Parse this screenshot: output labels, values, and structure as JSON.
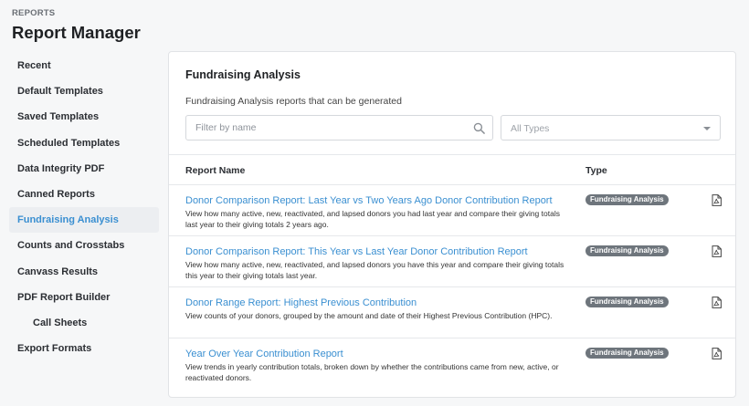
{
  "header": {
    "eyebrow": "REPORTS",
    "title": "Report Manager"
  },
  "sidebar": {
    "items": [
      {
        "label": "Recent"
      },
      {
        "label": "Default Templates"
      },
      {
        "label": "Saved Templates"
      },
      {
        "label": "Scheduled Templates"
      },
      {
        "label": "Data Integrity PDF"
      },
      {
        "label": "Canned Reports"
      },
      {
        "label": "Fundraising Analysis",
        "active": true
      },
      {
        "label": "Counts and Crosstabs"
      },
      {
        "label": "Canvass Results"
      },
      {
        "label": "PDF Report Builder"
      },
      {
        "label": "Call Sheets",
        "sub": true
      },
      {
        "label": "Export Formats"
      }
    ]
  },
  "main": {
    "title": "Fundraising Analysis",
    "description": "Fundraising Analysis reports that can be generated",
    "filter": {
      "placeholder": "Filter by name",
      "value": "",
      "icon": "search-icon"
    },
    "type_select": {
      "selected": "All Types"
    },
    "columns": {
      "name": "Report Name",
      "type": "Type"
    },
    "rows": [
      {
        "name": "Donor Comparison Report: Last Year vs Two Years Ago Donor Contribution Report",
        "description": "View how many active, new, reactivated, and lapsed donors you had last year and compare their giving totals last year to their giving totals 2 years ago.",
        "type": "Fundraising Analysis",
        "action_icon": "pdf-icon"
      },
      {
        "name": "Donor Comparison Report: This Year vs Last Year Donor Contribution Report",
        "description": "View how many active, new, reactivated, and lapsed donors you have this year and compare their giving totals this year to their giving totals last year.",
        "type": "Fundraising Analysis",
        "action_icon": "pdf-icon"
      },
      {
        "name": "Donor Range Report: Highest Previous Contribution",
        "description": "View counts of your donors, grouped by the amount and date of their Highest Previous Contribution (HPC).",
        "type": "Fundraising Analysis",
        "action_icon": "pdf-icon"
      },
      {
        "name": "Year Over Year Contribution Report",
        "description": "View trends in yearly contribution totals, broken down by whether the contributions came from new, active, or reactivated donors.",
        "type": "Fundraising Analysis",
        "action_icon": "pdf-icon"
      }
    ]
  },
  "colors": {
    "accent": "#3a8fd1",
    "badge": "#6e757c",
    "background": "#f6f7f8"
  }
}
